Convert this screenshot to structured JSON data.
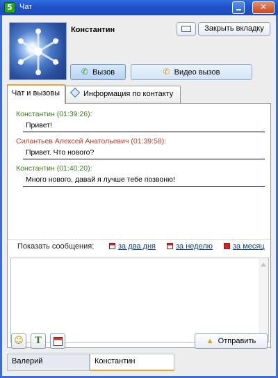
{
  "window": {
    "title": "Чат",
    "app_icon_letter": "5"
  },
  "contact": {
    "name": "Константин"
  },
  "buttons": {
    "close_tab": "Закрыть вкладку",
    "call": "Вызов",
    "video_call": "Видео вызов",
    "send": "Отправить"
  },
  "tabs": [
    {
      "label": "Чат и вызовы",
      "active": true
    },
    {
      "label": "Информация по контакту",
      "active": false
    }
  ],
  "messages": [
    {
      "header": "Константин (01:39:26):",
      "text": "Привет!",
      "color": "#3e7d1c"
    },
    {
      "header": "Силантьев Алексей Анатольевич (01:39:58):",
      "text": "Привет. Что нового?",
      "color": "#c0392b"
    },
    {
      "header": "Константин (01:40:20):",
      "text": "Много нового, давай я лучше тебе позвоню!",
      "color": "#3e7d1c"
    }
  ],
  "history": {
    "label": "Показать сообщения:",
    "links": [
      "за два дня",
      "за неделю",
      "за месяц"
    ]
  },
  "contact_tabs": [
    {
      "label": "Валерий",
      "active": false
    },
    {
      "label": "Константин",
      "active": true
    }
  ],
  "icons": {
    "smile": "smile-icon",
    "font": "font-icon",
    "calendar": "calendar-icon",
    "card": "business-card-icon",
    "phone": "phone-icon",
    "send": "send-arrow-icon"
  }
}
